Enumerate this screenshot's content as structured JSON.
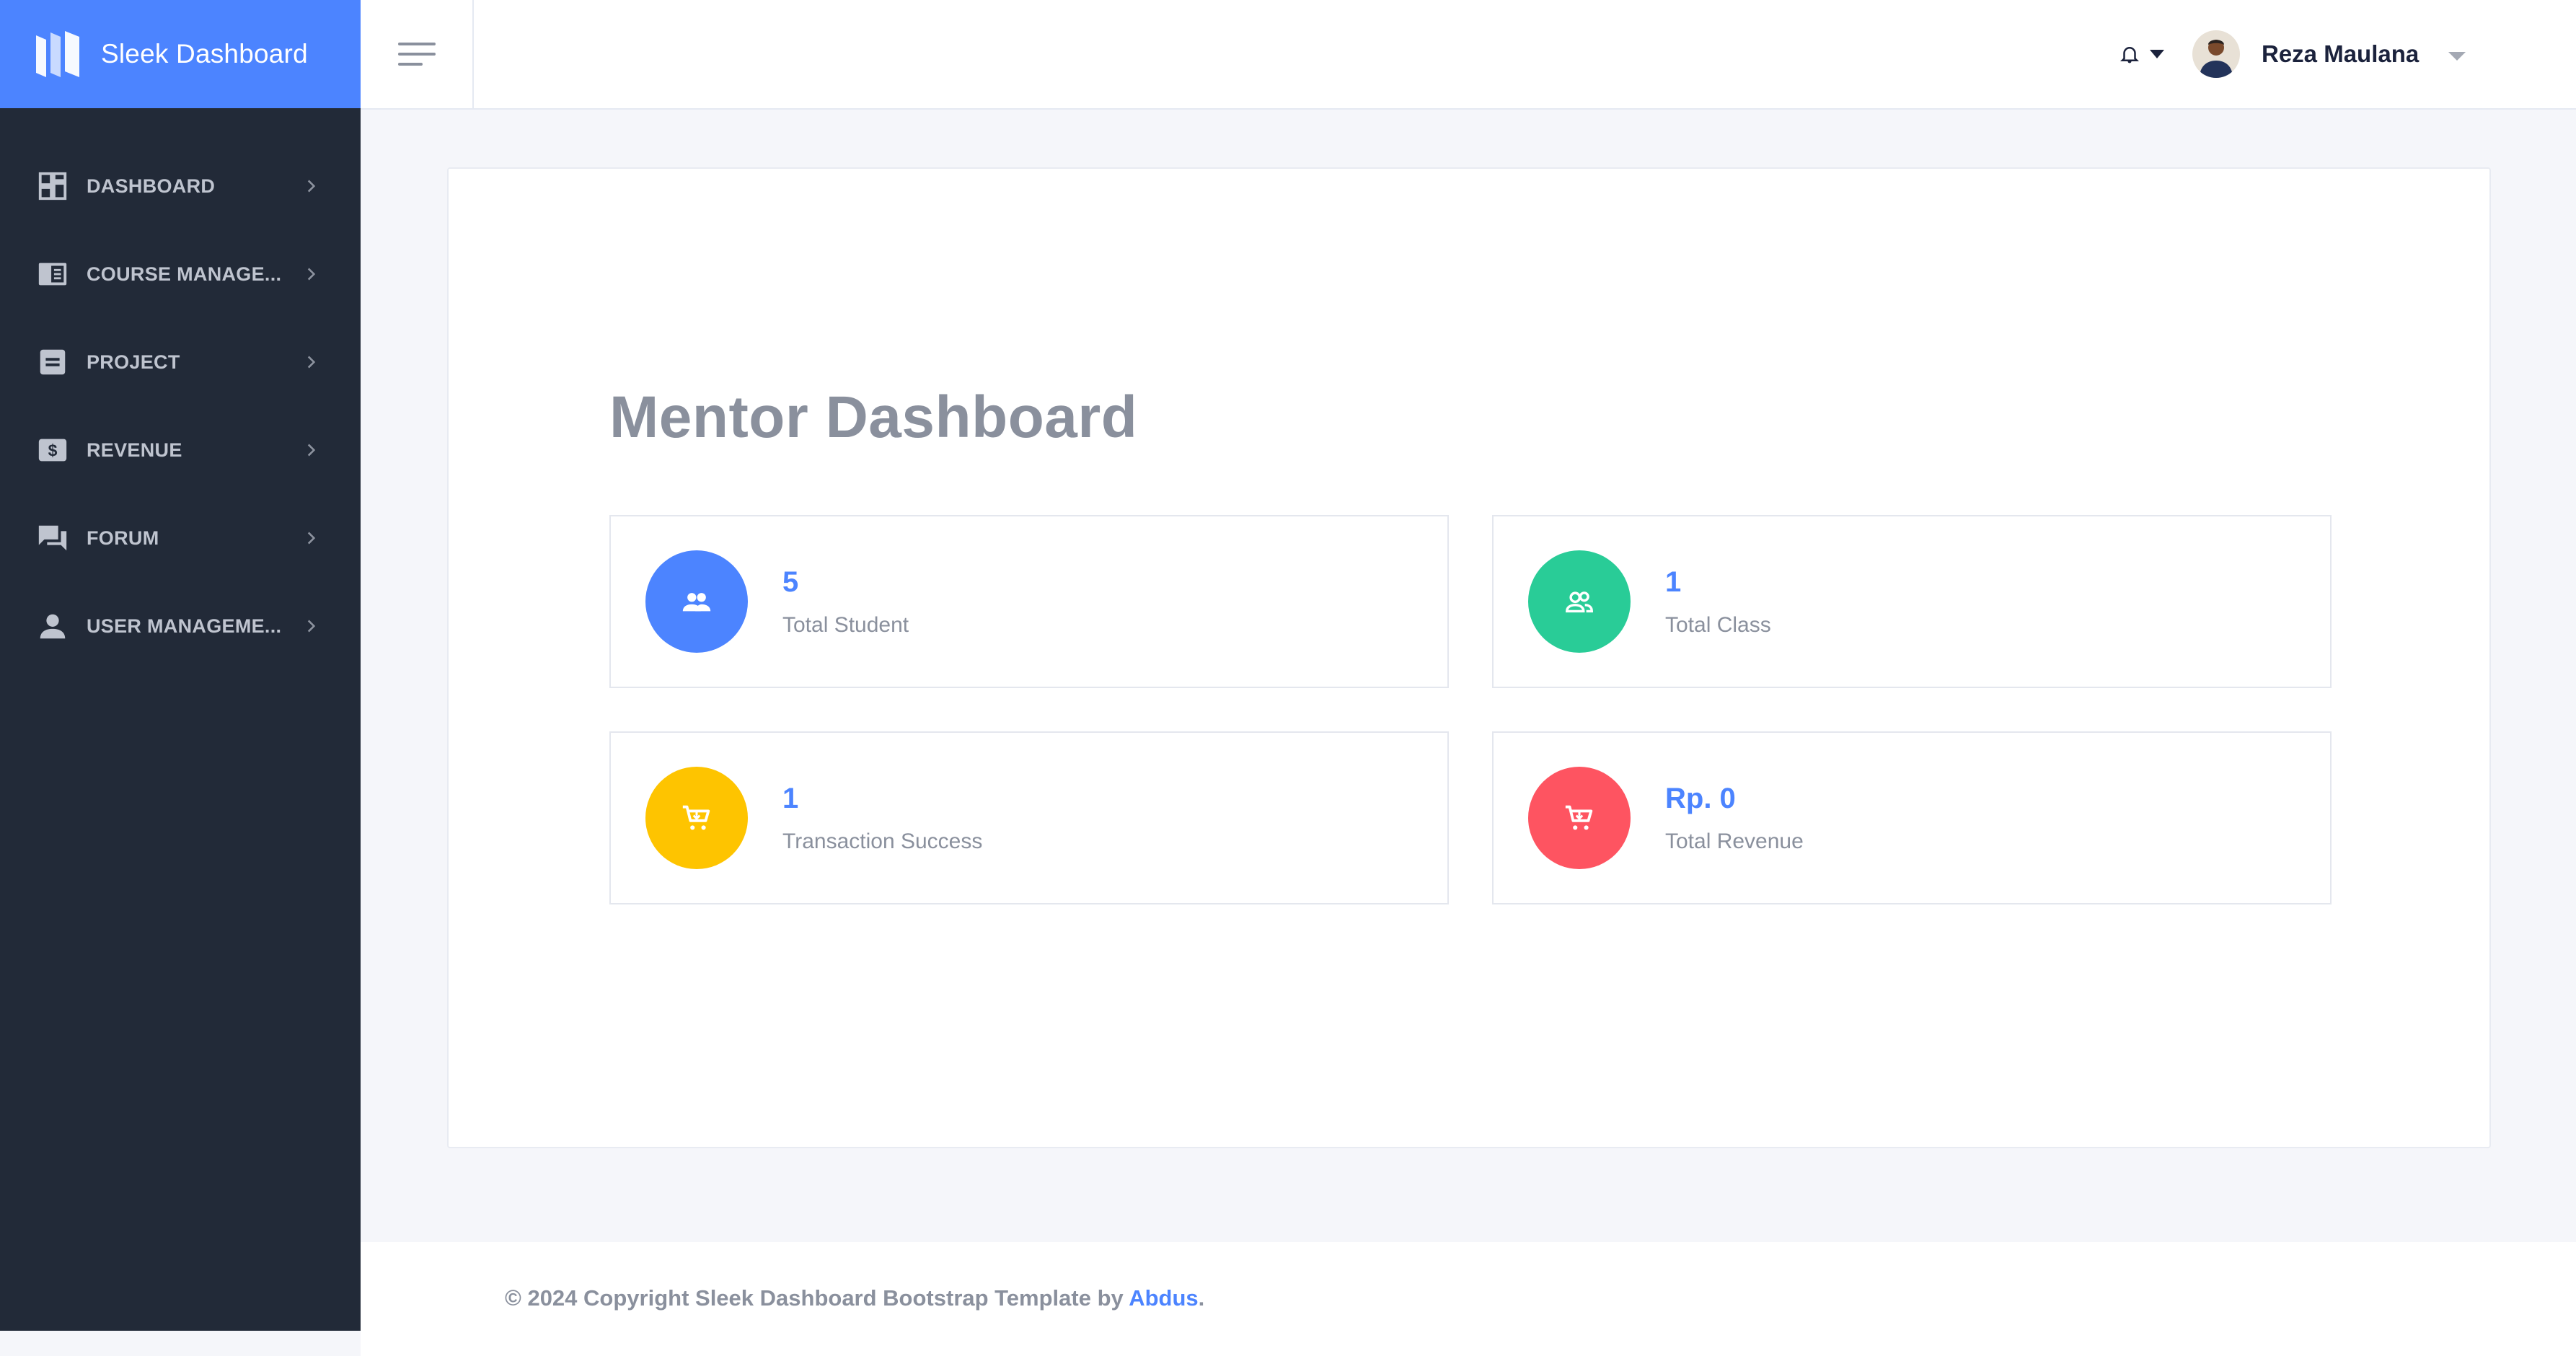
{
  "brand": {
    "name": "Sleek Dashboard",
    "logo_icon": "brand-logo-icon",
    "color": "#4c84ff"
  },
  "sidebar": {
    "background": "#222a38",
    "items": [
      {
        "label": "DASHBOARD",
        "icon": "dashboard-icon"
      },
      {
        "label": "COURSE MANAGE...",
        "icon": "book-icon"
      },
      {
        "label": "PROJECT",
        "icon": "project-icon"
      },
      {
        "label": "REVENUE",
        "icon": "money-icon"
      },
      {
        "label": "FORUM",
        "icon": "forum-icon"
      },
      {
        "label": "USER MANAGEME...",
        "icon": "user-icon"
      }
    ]
  },
  "header": {
    "toggle_icon": "menu-toggle-icon",
    "notification_icon": "bell-icon",
    "user_name": "Reza Maulana"
  },
  "main": {
    "title": "Mentor Dashboard",
    "stats": [
      {
        "value": "5",
        "label": "Total Student",
        "icon": "users-icon",
        "color": "#4c84ff"
      },
      {
        "value": "1",
        "label": "Total Class",
        "icon": "group-icon",
        "color": "#29cc97"
      },
      {
        "value": "1",
        "label": "Transaction Success",
        "icon": "cart-icon",
        "color": "#fec400"
      },
      {
        "value": "Rp. 0",
        "label": "Total Revenue",
        "icon": "cart-icon",
        "color": "#fe5461"
      }
    ]
  },
  "footer": {
    "text": "© 2024 Copyright Sleek Dashboard Bootstrap Template by ",
    "link": "Abdus",
    "suffix": "."
  }
}
